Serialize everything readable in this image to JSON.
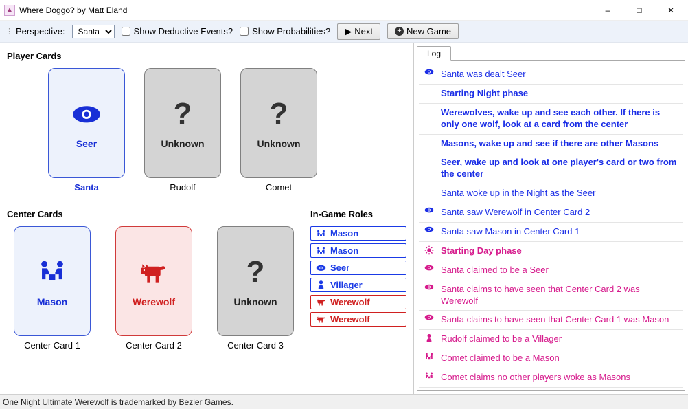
{
  "window": {
    "title": "Where Doggo? by Matt Eland"
  },
  "toolbar": {
    "perspective_label": "Perspective:",
    "perspective_value": "Santa",
    "show_deductive": "Show Deductive Events?",
    "show_probabilities": "Show Probabilities?",
    "next": "Next",
    "new_game": "New Game"
  },
  "sections": {
    "player_cards": "Player Cards",
    "center_cards": "Center Cards",
    "roles": "In-Game Roles"
  },
  "player_cards": [
    {
      "role": "Seer",
      "owner": "Santa",
      "style": "blue",
      "icon": "eye",
      "owner_bold": true
    },
    {
      "role": "Unknown",
      "owner": "Rudolf",
      "style": "gray",
      "icon": "question",
      "owner_bold": false
    },
    {
      "role": "Unknown",
      "owner": "Comet",
      "style": "gray",
      "icon": "question",
      "owner_bold": false
    }
  ],
  "center_cards": [
    {
      "role": "Mason",
      "owner": "Center Card 1",
      "style": "blue",
      "icon": "mason"
    },
    {
      "role": "Werewolf",
      "owner": "Center Card 2",
      "style": "red",
      "icon": "wolf"
    },
    {
      "role": "Unknown",
      "owner": "Center Card 3",
      "style": "gray",
      "icon": "question"
    }
  ],
  "roles": [
    {
      "label": "Mason",
      "color": "blue",
      "icon": "mason"
    },
    {
      "label": "Mason",
      "color": "blue",
      "icon": "mason"
    },
    {
      "label": "Seer",
      "color": "blue",
      "icon": "eye"
    },
    {
      "label": "Villager",
      "color": "blue",
      "icon": "villager"
    },
    {
      "label": "Werewolf",
      "color": "red",
      "icon": "wolf"
    },
    {
      "label": "Werewolf",
      "color": "red",
      "icon": "wolf"
    }
  ],
  "log_tab": "Log",
  "log": [
    {
      "icon": "eye",
      "text": "Santa was dealt Seer",
      "style": "blue"
    },
    {
      "icon": "moon",
      "text": "Starting Night phase",
      "style": "blue bold"
    },
    {
      "icon": "moon",
      "text": "Werewolves, wake up and see each other. If there is only one wolf, look at a card from the center",
      "style": "blue bold"
    },
    {
      "icon": "moon",
      "text": "Masons, wake up and see if there are other Masons",
      "style": "blue bold"
    },
    {
      "icon": "moon",
      "text": "Seer, wake up and look at one player's card or two from the center",
      "style": "blue bold"
    },
    {
      "icon": "moon",
      "text": "Santa woke up in the Night as the Seer",
      "style": "blue"
    },
    {
      "icon": "eye",
      "text": "Santa saw Werewolf in Center Card 2",
      "style": "blue"
    },
    {
      "icon": "eye",
      "text": "Santa saw Mason in Center Card 1",
      "style": "blue"
    },
    {
      "icon": "sun",
      "text": "Starting Day phase",
      "style": "pink bold"
    },
    {
      "icon": "eye",
      "text": "Santa claimed to be a Seer",
      "style": "pink"
    },
    {
      "icon": "eye",
      "text": "Santa claims to have seen that Center Card 2 was Werewolf",
      "style": "pink"
    },
    {
      "icon": "eye",
      "text": "Santa claims to have seen that Center Card 1 was Mason",
      "style": "pink"
    },
    {
      "icon": "villager",
      "text": "Rudolf claimed to be a Villager",
      "style": "pink"
    },
    {
      "icon": "mason",
      "text": "Comet claimed to be a Mason",
      "style": "pink"
    },
    {
      "icon": "mason",
      "text": "Comet claims no other players woke as Masons",
      "style": "pink"
    }
  ],
  "footer": "One Night Ultimate Werewolf is trademarked by Bezier Games."
}
